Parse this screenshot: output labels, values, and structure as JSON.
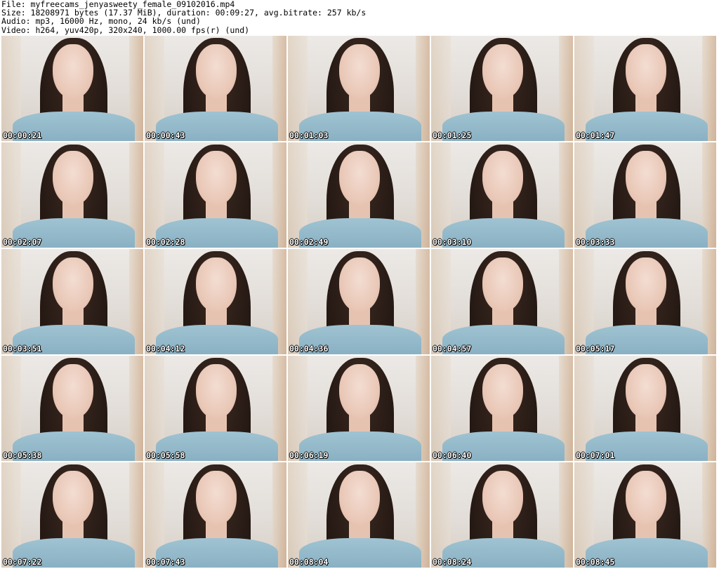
{
  "header": {
    "file_line": "File: myfreecams_jenyasweety_female_09102016.mp4",
    "size_line": "Size: 18208971 bytes (17.37 MiB), duration: 00:09:27, avg.bitrate: 257 kb/s",
    "audio_line": "Audio: mp3, 16000 Hz, mono, 24 kb/s (und)",
    "video_line": "Video: h264, yuv420p, 320x240, 1000.00 fps(r) (und)"
  },
  "thumbnails": [
    {
      "timestamp": "00:00:21"
    },
    {
      "timestamp": "00:00:43"
    },
    {
      "timestamp": "00:01:03"
    },
    {
      "timestamp": "00:01:25"
    },
    {
      "timestamp": "00:01:47"
    },
    {
      "timestamp": "00:02:07"
    },
    {
      "timestamp": "00:02:28"
    },
    {
      "timestamp": "00:02:49"
    },
    {
      "timestamp": "00:03:10"
    },
    {
      "timestamp": "00:03:33"
    },
    {
      "timestamp": "00:03:51"
    },
    {
      "timestamp": "00:04:12"
    },
    {
      "timestamp": "00:04:36"
    },
    {
      "timestamp": "00:04:57"
    },
    {
      "timestamp": "00:05:17"
    },
    {
      "timestamp": "00:05:38"
    },
    {
      "timestamp": "00:05:58"
    },
    {
      "timestamp": "00:06:19"
    },
    {
      "timestamp": "00:06:40"
    },
    {
      "timestamp": "00:07:01"
    },
    {
      "timestamp": "00:07:22"
    },
    {
      "timestamp": "00:07:43"
    },
    {
      "timestamp": "00:08:04"
    },
    {
      "timestamp": "00:08:24"
    },
    {
      "timestamp": "00:08:45"
    }
  ]
}
